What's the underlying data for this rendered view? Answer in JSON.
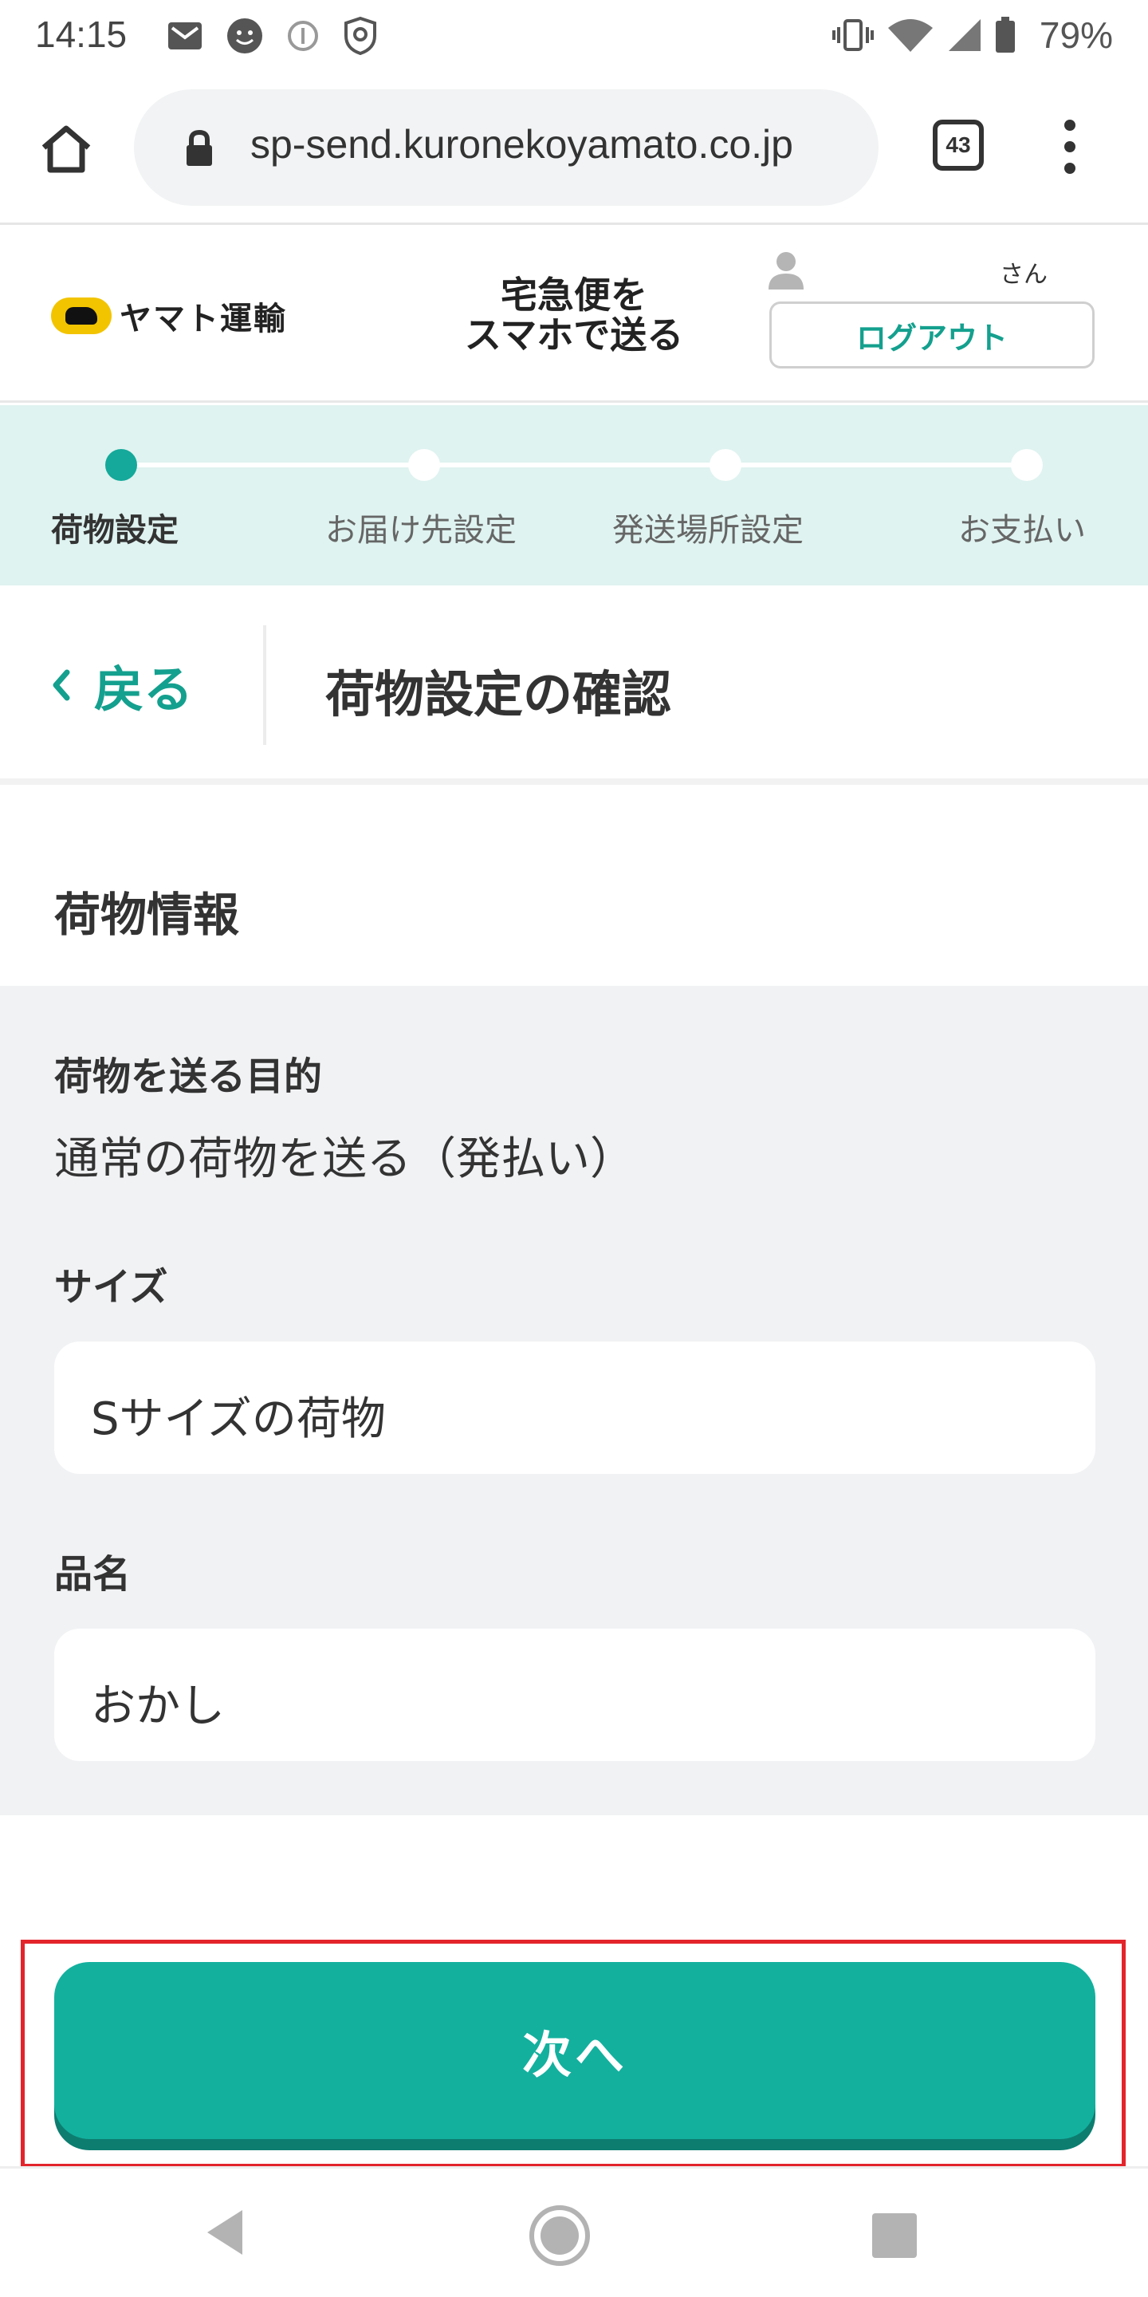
{
  "status_bar": {
    "time": "14:15",
    "battery_percent": "79%",
    "left_icons": [
      "gmail-icon",
      "face-icon",
      "info-icon",
      "shield-icon"
    ],
    "right_icons": [
      "vibrate-icon",
      "wifi-icon",
      "signal-icon",
      "battery-icon"
    ]
  },
  "browser": {
    "url": "sp-send.kuronekoyamato.co.jp",
    "tab_count": "43"
  },
  "header": {
    "logo_text": "ヤマト運輸",
    "service_title_line1": "宅急便を",
    "service_title_line2": "スマホで送る",
    "user_suffix": "さん",
    "logout_label": "ログアウト"
  },
  "stepper": {
    "current_index": 0,
    "steps": [
      {
        "label": "荷物設定"
      },
      {
        "label": "お届け先設定"
      },
      {
        "label": "発送場所設定"
      },
      {
        "label": "お支払い"
      }
    ]
  },
  "title_row": {
    "back_label": "戻る",
    "page_title": "荷物設定の確認"
  },
  "section": {
    "title": "荷物情報",
    "purpose_label": "荷物を送る目的",
    "purpose_value": "通常の荷物を送る（発払い）",
    "size_label": "サイズ",
    "size_value": "Sサイズの荷物",
    "item_label": "品名",
    "item_value": "おかし"
  },
  "next_button": {
    "label": "次へ"
  },
  "colors": {
    "accent": "#13b09e",
    "stepper_bg": "#dff3f0",
    "highlight": "#e3242b"
  }
}
